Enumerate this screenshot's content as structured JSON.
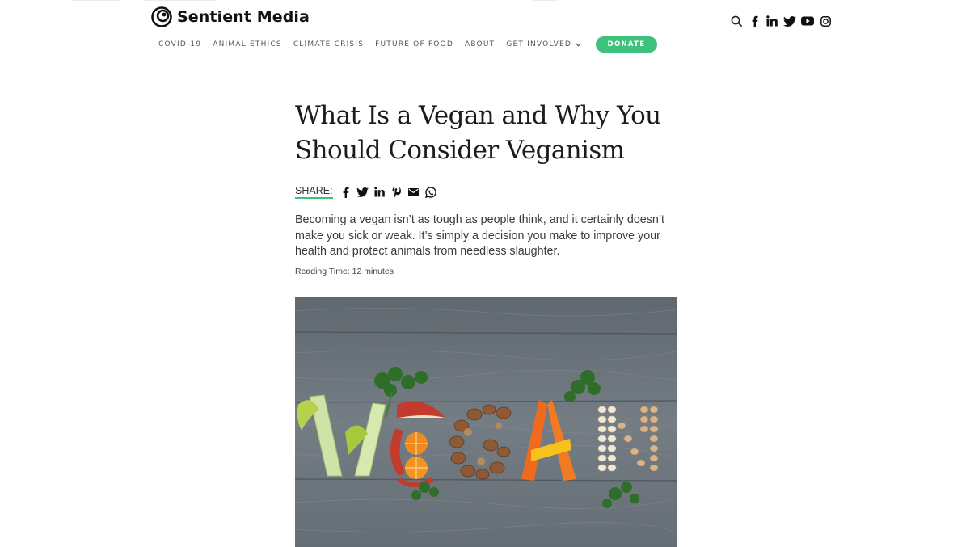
{
  "brand": {
    "name": "Sentient Media"
  },
  "nav": {
    "items": [
      "COVID-19",
      "ANIMAL ETHICS",
      "CLIMATE CRISIS",
      "FUTURE OF FOOD",
      "ABOUT",
      "GET INVOLVED"
    ],
    "donate_label": "DONATE"
  },
  "header_icons": [
    "search-icon",
    "facebook-icon",
    "linkedin-icon",
    "twitter-icon",
    "youtube-icon",
    "instagram-icon"
  ],
  "article": {
    "title": "What Is a Vegan and Why You Should Consider Veganism",
    "share_label": "SHARE:",
    "share_icons": [
      "facebook-icon",
      "twitter-icon",
      "linkedin-icon",
      "pinterest-icon",
      "email-icon",
      "whatsapp-icon"
    ],
    "lede": "Becoming a vegan isn’t as tough as people think, and it certainly doesn’t make you sick or weak. It’s simply a decision you make to improve your health and protect animals from needless slaughter.",
    "reading_time": "Reading Time: 12 minutes"
  },
  "colors": {
    "accent": "#3ec17c",
    "text": "#1c1c1c",
    "wood": "#6b737b"
  }
}
